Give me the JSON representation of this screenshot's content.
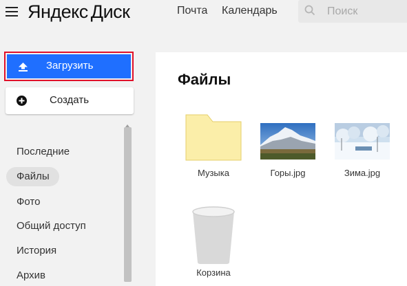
{
  "header": {
    "logo_brand": "Яндекс",
    "logo_product": "Диск",
    "nav": [
      "Почта",
      "Календарь"
    ],
    "search_placeholder": "Поиск"
  },
  "sidebar": {
    "upload_label": "Загрузить",
    "create_label": "Создать",
    "items": [
      {
        "label": "Последние",
        "active": false
      },
      {
        "label": "Файлы",
        "active": true
      },
      {
        "label": "Фото",
        "active": false
      },
      {
        "label": "Общий доступ",
        "active": false
      },
      {
        "label": "История",
        "active": false
      },
      {
        "label": "Архив",
        "active": false
      }
    ]
  },
  "main": {
    "title": "Файлы",
    "items": [
      {
        "name": "Музыка",
        "type": "folder"
      },
      {
        "name": "Горы.jpg",
        "type": "image"
      },
      {
        "name": "Зима.jpg",
        "type": "image"
      },
      {
        "name": "Корзина",
        "type": "trash"
      }
    ]
  },
  "colors": {
    "accent": "#1f6fff",
    "highlight_border": "#e0102a",
    "folder": "#fbeea9"
  }
}
